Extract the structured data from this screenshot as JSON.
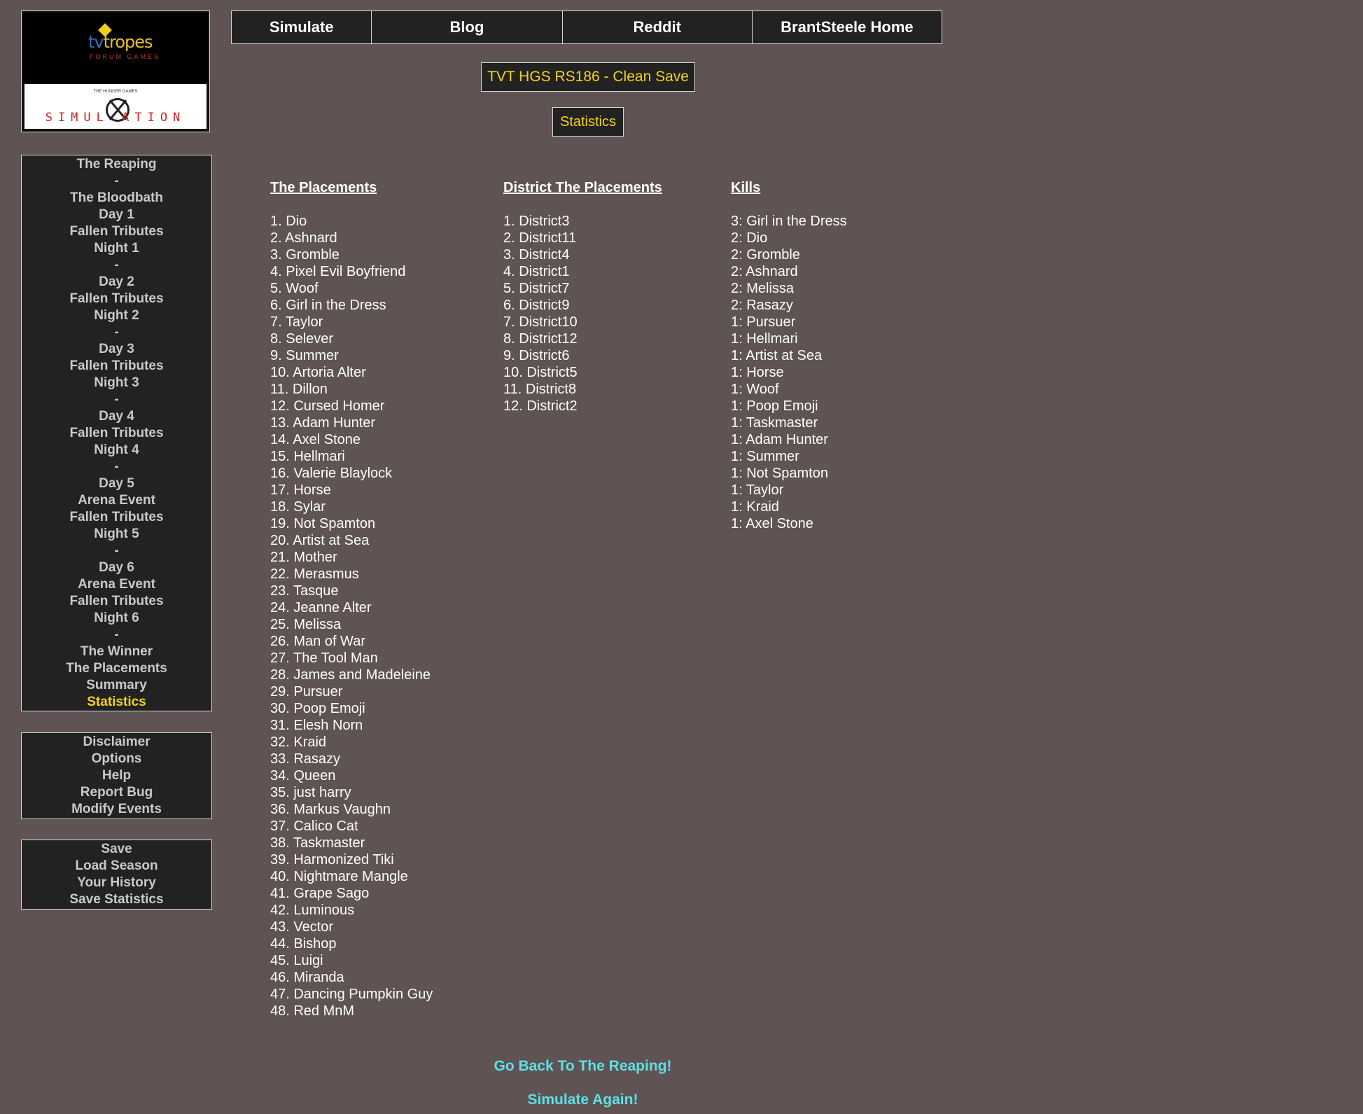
{
  "logo": {
    "top_text_a": "tv",
    "top_text_b": "tropes",
    "top_sub": "FORUM GAMES",
    "small_text": "THE HUNGER GAMES",
    "sim_text": "SIMUL  ATION"
  },
  "sidebar": {
    "nav": [
      {
        "label": "The Reaping",
        "type": "item"
      },
      {
        "label": "-",
        "type": "sep"
      },
      {
        "label": "The Bloodbath",
        "type": "item"
      },
      {
        "label": "Day 1",
        "type": "item"
      },
      {
        "label": "Fallen Tributes",
        "type": "item"
      },
      {
        "label": "Night 1",
        "type": "item"
      },
      {
        "label": "-",
        "type": "sep"
      },
      {
        "label": "Day 2",
        "type": "item"
      },
      {
        "label": "Fallen Tributes",
        "type": "item"
      },
      {
        "label": "Night 2",
        "type": "item"
      },
      {
        "label": "-",
        "type": "sep"
      },
      {
        "label": "Day 3",
        "type": "item"
      },
      {
        "label": "Fallen Tributes",
        "type": "item"
      },
      {
        "label": "Night 3",
        "type": "item"
      },
      {
        "label": "-",
        "type": "sep"
      },
      {
        "label": "Day 4",
        "type": "item"
      },
      {
        "label": "Fallen Tributes",
        "type": "item"
      },
      {
        "label": "Night 4",
        "type": "item"
      },
      {
        "label": "-",
        "type": "sep"
      },
      {
        "label": "Day 5",
        "type": "item"
      },
      {
        "label": "Arena Event",
        "type": "item"
      },
      {
        "label": "Fallen Tributes",
        "type": "item"
      },
      {
        "label": "Night 5",
        "type": "item"
      },
      {
        "label": "-",
        "type": "sep"
      },
      {
        "label": "Day 6",
        "type": "item"
      },
      {
        "label": "Arena Event",
        "type": "item"
      },
      {
        "label": "Fallen Tributes",
        "type": "item"
      },
      {
        "label": "Night 6",
        "type": "item"
      },
      {
        "label": "-",
        "type": "sep"
      },
      {
        "label": "The Winner",
        "type": "item"
      },
      {
        "label": "The Placements",
        "type": "item"
      },
      {
        "label": "Summary",
        "type": "item"
      },
      {
        "label": "Statistics",
        "type": "item",
        "active": true
      }
    ],
    "info": [
      "Disclaimer",
      "Options",
      "Help",
      "Report Bug",
      "Modify Events"
    ],
    "save": [
      "Save",
      "Load Season",
      "Your History",
      "Save Statistics"
    ]
  },
  "topnav": {
    "simulate": "Simulate",
    "blog": "Blog",
    "reddit": "Reddit",
    "home": "BrantSteele Home"
  },
  "header": {
    "season_title": "TVT HGS RS186 - Clean Save",
    "page_title": "Statistics"
  },
  "placements": {
    "heading": "The Placements",
    "rows": [
      "1. Dio",
      "2. Ashnard",
      "3. Gromble",
      "4. Pixel Evil Boyfriend",
      "5. Woof",
      "6. Girl in the Dress",
      "7. Taylor",
      "8. Selever",
      "9. Summer",
      "10. Artoria Alter",
      "11. Dillon",
      "12. Cursed Homer",
      "13. Adam Hunter",
      "14. Axel Stone",
      "15. Hellmari",
      "16. Valerie Blaylock",
      "17. Horse",
      "18. Sylar",
      "19. Not Spamton",
      "20. Artist at Sea",
      "21. Mother",
      "22. Merasmus",
      "23. Tasque",
      "24. Jeanne Alter",
      "25. Melissa",
      "26. Man of War",
      "27. The Tool Man",
      "28. James and Madeleine",
      "29. Pursuer",
      "30. Poop Emoji",
      "31. Elesh Norn",
      "32. Kraid",
      "33. Rasazy",
      "34. Queen",
      "35. just harry",
      "36. Markus Vaughn",
      "37. Calico Cat",
      "38. Taskmaster",
      "39. Harmonized Tiki",
      "40. Nightmare Mangle",
      "41. Grape Sago",
      "42. Luminous",
      "43. Vector",
      "44. Bishop",
      "45. Luigi",
      "46. Miranda",
      "47. Dancing Pumpkin Guy",
      "48. Red MnM"
    ]
  },
  "district_placements": {
    "heading": "District The Placements",
    "rows": [
      "1. District3",
      "2. District11",
      "3. District4",
      "4. District1",
      "5. District7",
      "6. District9",
      "7. District10",
      "8. District12",
      "9. District6",
      "10. District5",
      "11. District8",
      "12. District2"
    ]
  },
  "kills": {
    "heading": "Kills",
    "rows": [
      "3: Girl in the Dress",
      "2: Dio",
      "2: Gromble",
      "2: Ashnard",
      "2: Melissa",
      "2: Rasazy",
      "1: Pursuer",
      "1: Hellmari",
      "1: Artist at Sea",
      "1: Horse",
      "1: Woof",
      "1: Poop Emoji",
      "1: Taskmaster",
      "1: Adam Hunter",
      "1: Summer",
      "1: Not Spamton",
      "1: Taylor",
      "1: Kraid",
      "1: Axel Stone"
    ]
  },
  "footer": {
    "back_link": "Go Back To The Reaping!",
    "again_link": "Simulate Again!"
  },
  "colors": {
    "background": "#5f5353",
    "panel": "#222222",
    "accent_yellow": "#f4d21a",
    "link_cyan": "#5ce1e6"
  }
}
